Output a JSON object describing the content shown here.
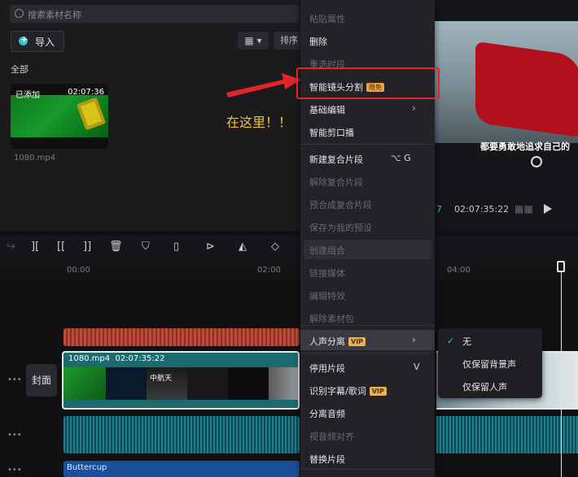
{
  "media": {
    "search_placeholder": "搜索素材名称",
    "import_label": "导入",
    "view_label": "▦ ▾",
    "sort_label": "排序",
    "filter_all": "全部",
    "clip": {
      "added": "已添加",
      "duration": "02:07:36",
      "name": "1080.mp4"
    }
  },
  "annotation": {
    "text": "在这里！！",
    "color": "#f2c12e",
    "highlight_color": "#e5232b"
  },
  "preview": {
    "subtitle": "都要勇敢地追求自己的",
    "current_time_fragment": "7",
    "total_time": "02:07:35:22"
  },
  "ruler": {
    "ticks": [
      "00:00",
      "02:00",
      "04:00"
    ]
  },
  "timeline": {
    "main_clip_name": "1080.mp4",
    "main_clip_duration": "02:07:35:22",
    "cover_label": "封面",
    "music_label": "Buttercup",
    "frame_text": "中航天"
  },
  "context_menu": {
    "items": [
      {
        "label": "粘贴属性",
        "disabled": true
      },
      {
        "label": "删除",
        "disabled": false
      },
      {
        "label": "重选时段",
        "disabled": true
      },
      {
        "label": "智能镜头分割",
        "tag": "限免",
        "disabled": false
      },
      {
        "label": "基础编辑",
        "submenu": true,
        "disabled": false
      },
      {
        "label": "智能剪口播",
        "disabled": false
      },
      {
        "label": "新建复合片段",
        "shortcut": "⌥ G",
        "disabled": false
      },
      {
        "label": "解除复合片段",
        "disabled": true
      },
      {
        "label": "预合成复合片段",
        "disabled": true
      },
      {
        "label": "保存为我的预设",
        "disabled": true
      },
      {
        "label": "创建组合",
        "disabled": true
      },
      {
        "label": "链接媒体",
        "disabled": true
      },
      {
        "label": "编辑特效",
        "disabled": true
      },
      {
        "label": "解除素材包",
        "disabled": true
      },
      {
        "label": "人声分离",
        "tag": "VIP",
        "submenu": true,
        "disabled": false
      },
      {
        "label": "停用片段",
        "shortcut": "V",
        "disabled": false
      },
      {
        "label": "识别字幕/歌词",
        "tag": "VIP",
        "disabled": false
      },
      {
        "label": "分离音频",
        "disabled": false
      },
      {
        "label": "视音频对齐",
        "disabled": true
      },
      {
        "label": "替换片段",
        "disabled": false
      }
    ]
  },
  "submenu": {
    "items": [
      {
        "label": "无",
        "checked": true
      },
      {
        "label": "仅保留背景声",
        "checked": false
      },
      {
        "label": "仅保留人声",
        "checked": false
      }
    ],
    "check_mark": "✓"
  },
  "colors": {
    "accent": "#25c6d6",
    "menu_bg": "#232327",
    "vip": "#e7b15a"
  }
}
